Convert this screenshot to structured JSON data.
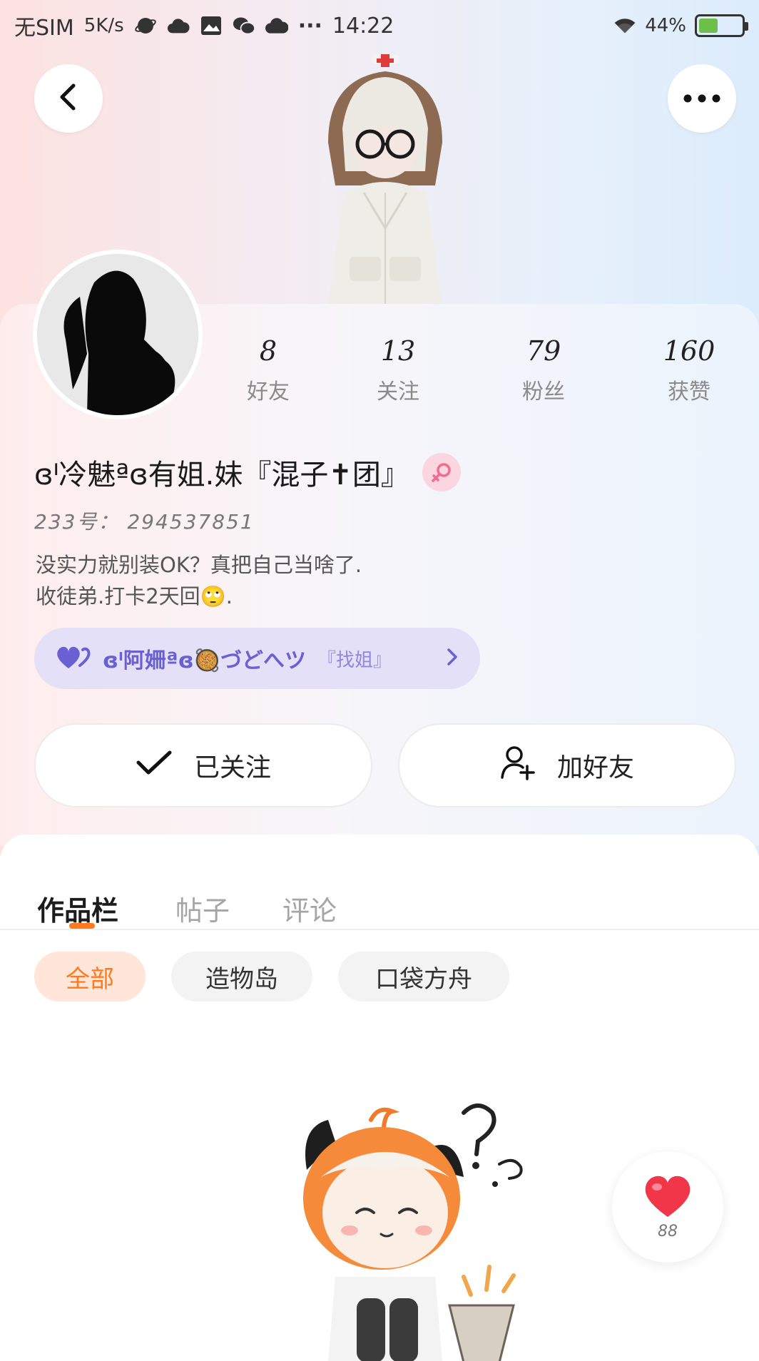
{
  "status_bar": {
    "carrier": "无SIM",
    "speed": "5K/s",
    "dots": "···",
    "time": "14:22",
    "battery": "44%",
    "battery_level": 0.44
  },
  "header": {
    "back_icon": "chevron-left-icon",
    "more_icon": "more-horizontal-icon"
  },
  "profile": {
    "stats": [
      {
        "value": "8",
        "label": "好友"
      },
      {
        "value": "13",
        "label": "关注"
      },
      {
        "value": "79",
        "label": "粉丝"
      },
      {
        "value": "160",
        "label": "获赞"
      }
    ],
    "username": "ɞᑊ冷魅ªɞ有姐.妹『混子✝团』",
    "gender_icon": "female-icon",
    "uid": "233号： 294537851",
    "bio_line1": "没实力就别装OK？真把自己当啥了.",
    "bio_line2": "收徒弟.打卡2天回🙄.",
    "partner": {
      "name": "ɞᑊ阿姍ªɞ🥘づどへツ",
      "tag": "『找姐』",
      "icon": "heart-icon"
    }
  },
  "actions": {
    "follow_label": "已关注",
    "add_friend_label": "加好友"
  },
  "tabs": {
    "items": [
      "作品栏",
      "帖子",
      "评论"
    ],
    "active": 0
  },
  "filters": {
    "items": [
      "全部",
      "造物岛",
      "口袋方舟"
    ],
    "active": 0
  },
  "like_fab": {
    "count": "88",
    "icon": "heart-icon"
  },
  "colors": {
    "accent": "#ff7a1e",
    "partner_text": "#6a5fd3",
    "partner_bg": "#e4e0f7",
    "gender_badge": "#fbd5df",
    "heart": "#f2364a"
  }
}
